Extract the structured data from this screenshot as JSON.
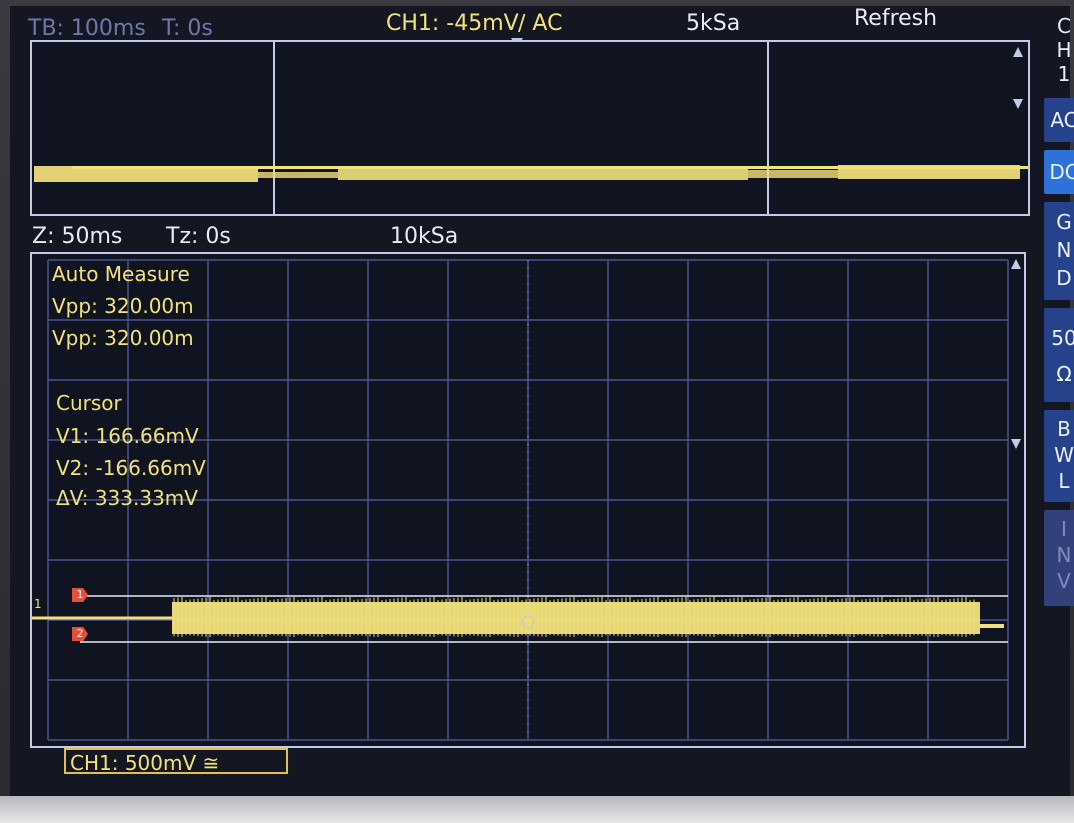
{
  "header": {
    "timebase": "TB: 100ms",
    "trigger_time": "T: 0s",
    "channel_setting": "CH1: -45mV",
    "coupling_edge": "∕ AC",
    "sample_rate": "5kSa",
    "mode": "Refresh"
  },
  "zoom_header": {
    "zoom": "Z: 50ms",
    "zoom_time": "Tz: 0s",
    "sample_rate": "10kSa"
  },
  "auto_measure": {
    "title": "Auto Measure",
    "items": [
      "Vpp: 320.00m",
      "Vpp: 320.00m"
    ]
  },
  "cursor": {
    "title": "Cursor",
    "v1": "V1: 166.66mV",
    "v2": "V2: -166.66mV",
    "dv": "ΔV: 333.33mV"
  },
  "markers": {
    "ch_ref": "1",
    "cursor1": "1",
    "cursor2": "2"
  },
  "scale_box": "CH1: 500mV ≅",
  "side_menu": {
    "channel": "C\nH\n1",
    "ac": "AC",
    "dc": "DC",
    "gnd": "G\nN\nD",
    "ohm": "50\nΩ",
    "bwl": "B\nW\nL",
    "inv": "I\nN\nV"
  },
  "colors": {
    "trace": "#f2e27a",
    "grid": "#4a5590",
    "accent": "#2c72d8"
  },
  "icons": [
    "trigger-arrow-icon",
    "scroll-up-icon",
    "scroll-down-icon",
    "crosshair-icon"
  ]
}
